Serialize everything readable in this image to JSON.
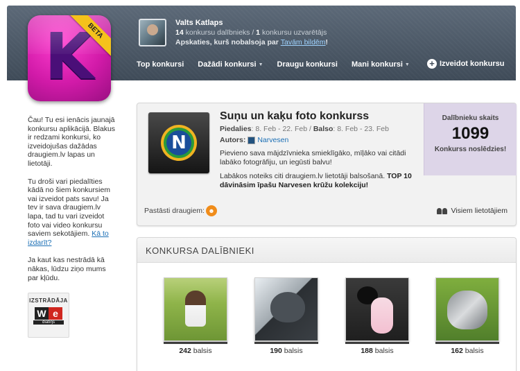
{
  "header": {
    "logo_letter": "K",
    "logo_badge": "BETA",
    "user": {
      "name": "Valts Katlaps",
      "participant_count": "14",
      "participant_text": "konkursu dalībnieks / ",
      "winner_count": "1",
      "winner_text": "konkursu uzvarētājs",
      "tagline_prefix": "Apskaties, kurš nobalsoja par ",
      "tagline_link": "Tavām bildēm",
      "tagline_suffix": "!"
    },
    "nav": [
      {
        "label": "Top konkursi",
        "dropdown": false
      },
      {
        "label": "Dažādi konkursi",
        "dropdown": true
      },
      {
        "label": "Draugu konkursi",
        "dropdown": false
      },
      {
        "label": "Mani konkursi",
        "dropdown": true
      }
    ],
    "create_label": "Izveidot konkursu",
    "caret_glyph": "▼",
    "plus_glyph": "+"
  },
  "sidebar": {
    "p1": "Čau! Tu esi ienācis jaunajā konkursu aplikācijā. Blakus ir redzami konkursi, ko izveidojušas dažādas draugiem.lv lapas un lietotāji.",
    "p2": "Tu droši vari piedalīties kādā no šiem konkursiem vai izveidot pats savu! Ja tev ir sava draugiem.lv lapa, tad tu vari izveidot foto vai video konkursu saviem sekotājiem. ",
    "p2_link": "Kā to izdarīt?",
    "p3": "Ja kaut kas nestrādā kā nākas, lūdzu ziņo mums par kļūdu.",
    "badge_caption": "IZSTRĀDĀJA",
    "badge_w": "W",
    "badge_e": "e",
    "badge_sub": "dīatīŋs"
  },
  "contest": {
    "logo_letter": "N",
    "title": "Suņu un kaķu foto konkurss",
    "dates_label1": "Piedalies",
    "dates_value1": ": 8. Feb - 22. Feb / ",
    "dates_label2": "Balso",
    "dates_value2": ": 8. Feb - 23. Feb",
    "author_label": "Autors:",
    "author_name": "Narvesen",
    "description": "Pievieno sava mājdzīvnieka smieklīgāko, mīļāko vai citādi labāko fotogrāfiju, un iegūsti balvu!",
    "prize_text": "Labākos noteiks citi draugiem.lv lietotāji balsošanā. ",
    "prize_bold": "TOP 10 dāvināsim īpašu Narvesen krūžu kolekciju!",
    "count_label": "Dalībnieku skaits",
    "count_value": "1099",
    "status": "Konkurss noslēdzies!",
    "share_label": "Pastāsti draugiem:",
    "share_glyph": "☻",
    "all_users_label": "Visiem lietotājiem"
  },
  "participants": {
    "heading": "KONKURSA DALĪBNIEKI",
    "votes_word": "balsis",
    "entries": [
      {
        "votes": "242"
      },
      {
        "votes": "190"
      },
      {
        "votes": "188"
      },
      {
        "votes": "162"
      }
    ]
  },
  "colors": {
    "header_bg": "#4e5a67",
    "logo_pink": "#d11aa8",
    "beta_yellow": "#f5c21b",
    "link_blue": "#1b6fb5",
    "count_box_bg": "#ddd5e8",
    "share_orange": "#f08c1a"
  }
}
